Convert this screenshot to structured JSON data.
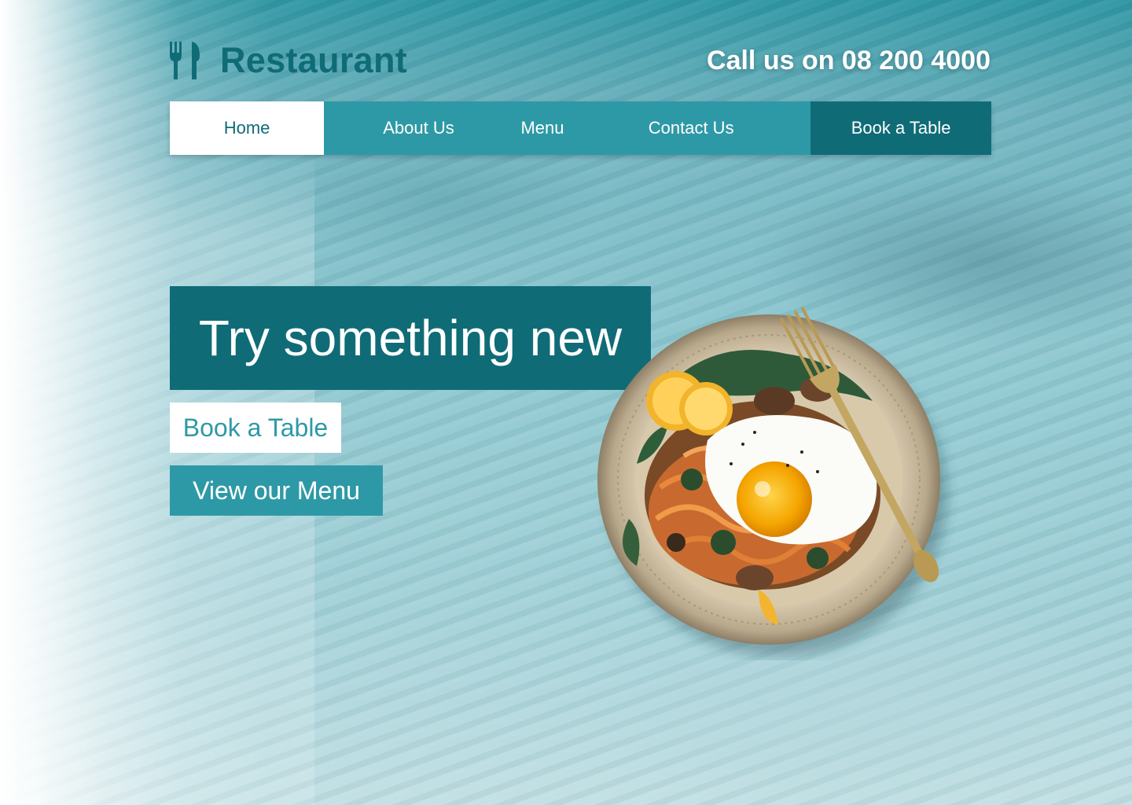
{
  "brand": {
    "name": "Restaurant",
    "icon": "fork-knife-icon"
  },
  "header": {
    "phone": "Call us on 08 200 4000"
  },
  "nav": {
    "items": [
      {
        "label": "Home",
        "active": true
      },
      {
        "label": "About Us"
      },
      {
        "label": "Menu"
      },
      {
        "label": "Contact Us"
      },
      {
        "label": "Book a Table"
      }
    ]
  },
  "hero": {
    "title": "Try something new",
    "book_button": "Book a Table",
    "menu_button": "View our Menu",
    "image": "plated-dish-with-fried-egg-and-fork"
  },
  "colors": {
    "primary_dark": "#0f6c77",
    "primary": "#2e99a6",
    "white": "#ffffff"
  }
}
